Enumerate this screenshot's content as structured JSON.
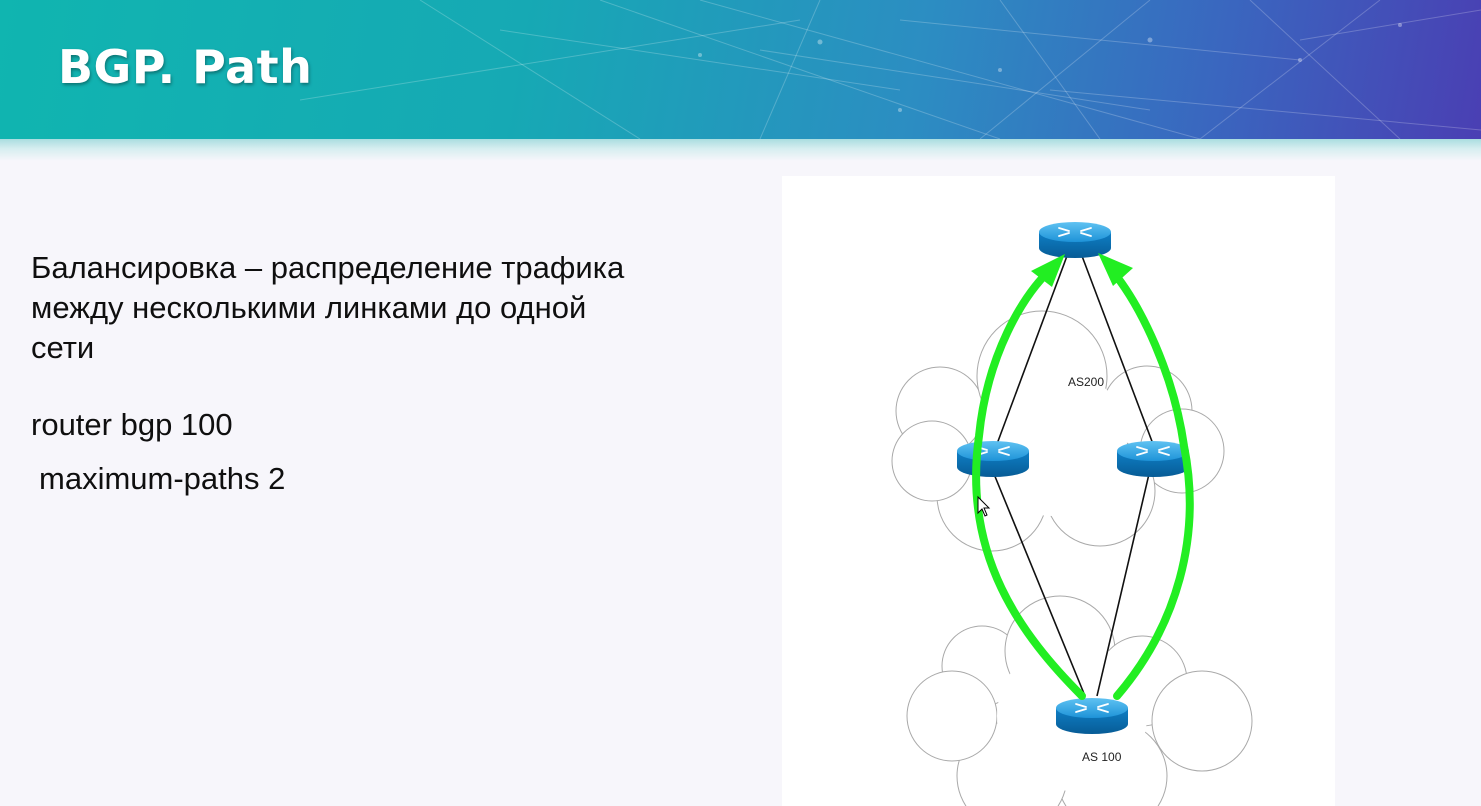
{
  "slide": {
    "title": "BGP. Path",
    "paragraph_lines": [
      "Балансировка – распределение трафика",
      "между несколькими линками до одной",
      "сети"
    ],
    "config_lines": [
      "router bgp 100",
      " maximum-paths 2"
    ]
  },
  "diagram": {
    "as200_label": "AS200",
    "as100_label": "AS 100",
    "arrow_color": "#22ee22",
    "router_color": "#1a8fd6",
    "routers": [
      "top-router",
      "middle-left-router",
      "middle-right-router",
      "bottom-router"
    ]
  },
  "colors": {
    "header_start": "#10b5b0",
    "header_end": "#4a3fb3",
    "title_text": "#ffffff",
    "background": "#f7f6fb"
  }
}
